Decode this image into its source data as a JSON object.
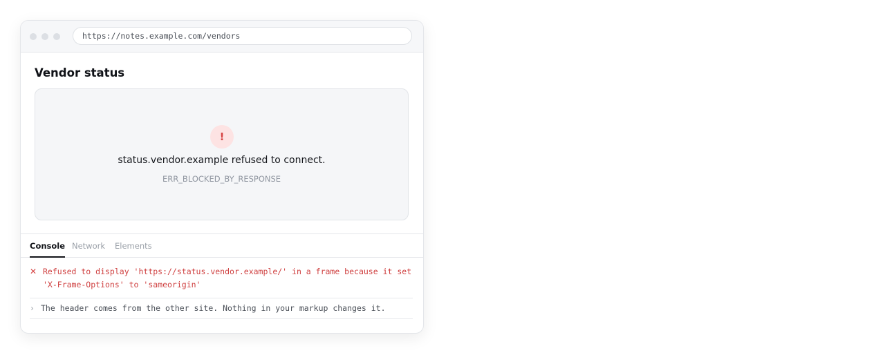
{
  "browser": {
    "url": "https://notes.example.com/vendors"
  },
  "page": {
    "title": "Vendor status"
  },
  "frame_error": {
    "icon": "!",
    "message": "status.vendor.example refused to connect.",
    "code": "ERR_BLOCKED_BY_RESPONSE"
  },
  "devtools": {
    "tabs": [
      {
        "label": "Console",
        "active": true
      },
      {
        "label": "Network",
        "active": false
      },
      {
        "label": "Elements",
        "active": false
      }
    ],
    "console": [
      {
        "type": "error",
        "icon": "✕",
        "text": "Refused to display 'https://status.vendor.example/' in a frame because it set\n'X-Frame-Options' to 'sameorigin'"
      },
      {
        "type": "log",
        "icon": "›",
        "text": "The header comes from the other site. Nothing in your markup changes it."
      }
    ]
  },
  "colors": {
    "error": "#d64545",
    "error_bg": "#fde3e3",
    "text": "#111318",
    "muted": "#9aa0a8"
  }
}
